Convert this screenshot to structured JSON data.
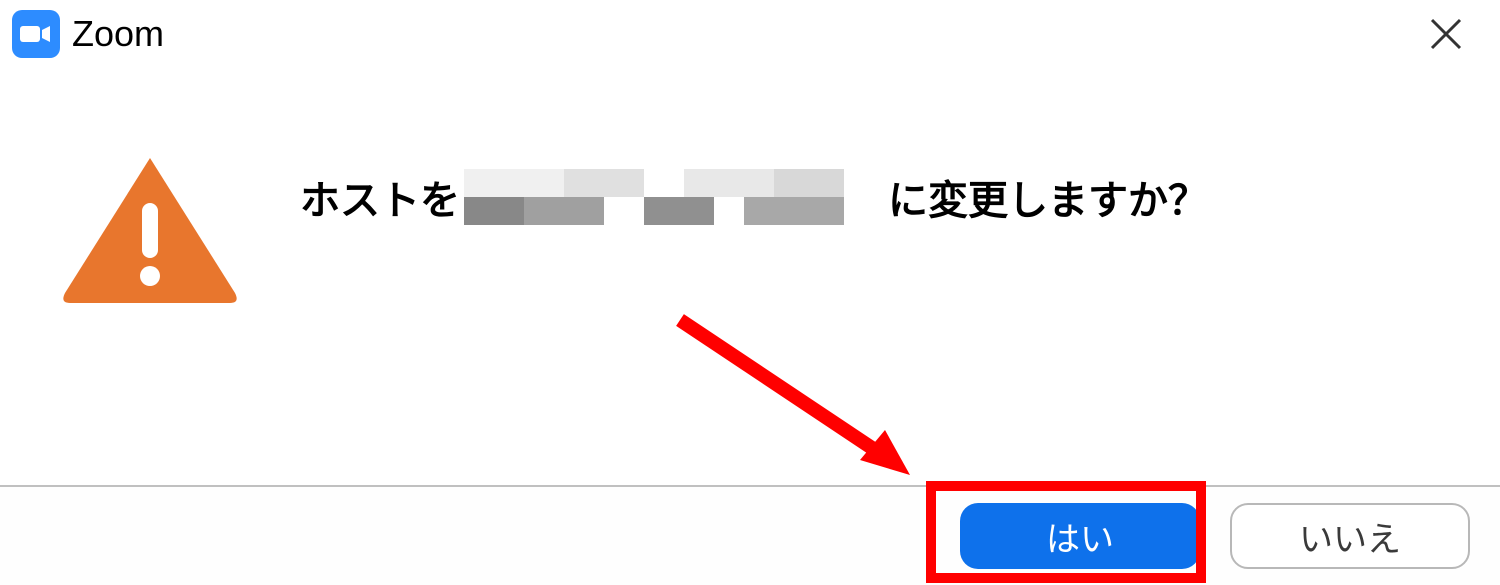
{
  "titleBar": {
    "appName": "Zoom"
  },
  "dialog": {
    "message": {
      "prefix": "ホストを",
      "suffix": "に変更しますか？"
    },
    "buttons": {
      "yes": "はい",
      "no": "いいえ"
    }
  },
  "colors": {
    "zoomBlue": "#2d8cff",
    "primaryButton": "#0e71eb",
    "warningOrange": "#e8762d",
    "annotationRed": "#ff0000"
  }
}
